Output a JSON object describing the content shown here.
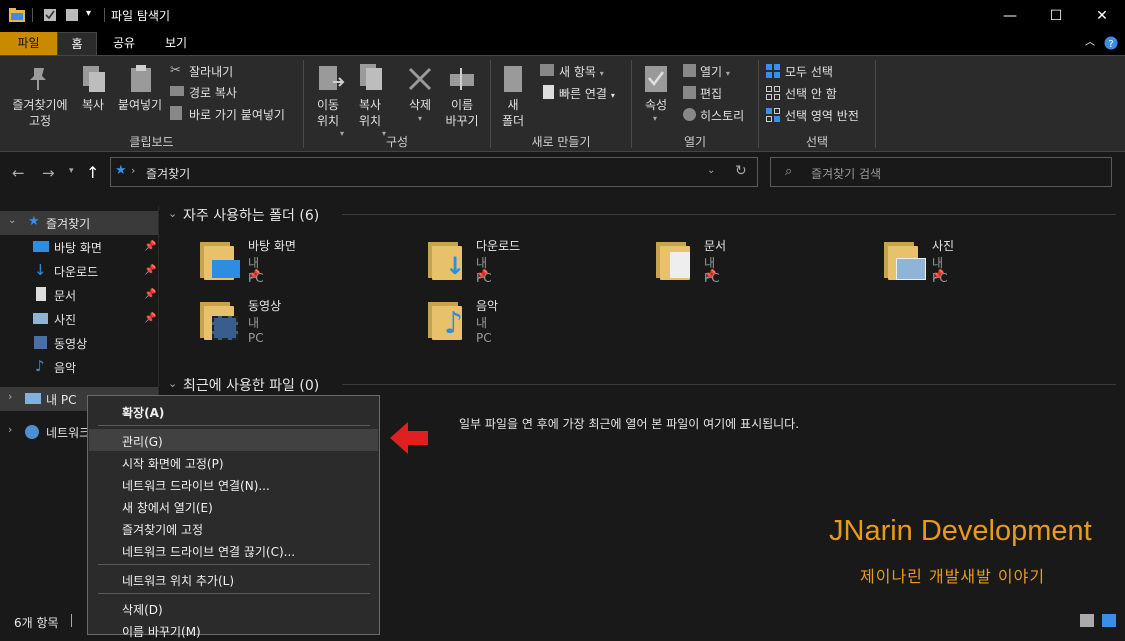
{
  "window": {
    "title": "파일 탐색기",
    "minimize": "—",
    "maximize": "☐",
    "close": "✕"
  },
  "tabs": {
    "file": "파일",
    "home": "홈",
    "share": "공유",
    "view": "보기"
  },
  "ribbon": {
    "clipboard": {
      "pin_quick": "즐겨찾기에\n고정",
      "copy": "복사",
      "paste": "붙여넣기",
      "cut": "잘라내기",
      "copy_path": "경로 복사",
      "paste_shortcut": "바로 가기 붙여넣기",
      "group": "클립보드"
    },
    "organize": {
      "move_to": "이동\n위치",
      "copy_to": "복사\n위치",
      "delete": "삭제",
      "rename": "이름\n바꾸기",
      "group": "구성"
    },
    "new": {
      "new_folder": "새\n폴더",
      "new_item": "새 항목",
      "easy_access": "빠른 연결",
      "group": "새로 만들기"
    },
    "open": {
      "properties": "속성",
      "open": "열기",
      "edit": "편집",
      "history": "히스토리",
      "group": "열기"
    },
    "select": {
      "select_all": "모두 선택",
      "select_none": "선택 안 함",
      "invert": "선택 영역 반전",
      "group": "선택"
    }
  },
  "address": {
    "path": "즐겨찾기",
    "search_placeholder": "즐겨찾기 검색"
  },
  "nav": {
    "quick_access": "즐겨찾기",
    "items": [
      "바탕 화면",
      "다운로드",
      "문서",
      "사진",
      "동영상",
      "음악"
    ],
    "this_pc": "내 PC",
    "network": "네트워크"
  },
  "content": {
    "frequent_header": "자주 사용하는 폴더 (6)",
    "recent_header": "최근에 사용한 파일 (0)",
    "folders": [
      {
        "name": "바탕 화면",
        "sub": "내 PC"
      },
      {
        "name": "다운로드",
        "sub": "내 PC"
      },
      {
        "name": "문서",
        "sub": "내 PC"
      },
      {
        "name": "사진",
        "sub": "내 PC"
      },
      {
        "name": "동영상",
        "sub": "내 PC"
      },
      {
        "name": "음악",
        "sub": "내 PC"
      }
    ],
    "recent_empty": "일부 파일을 연 후에 가장 최근에 열어 본 파일이 여기에 표시됩니다."
  },
  "context_menu": {
    "items": [
      "확장(A)",
      "관리(G)",
      "시작 화면에 고정(P)",
      "네트워크 드라이브 연결(N)...",
      "새 창에서 열기(E)",
      "즐겨찾기에 고정",
      "네트워크 드라이브 연결 끊기(C)...",
      "네트워크 위치 추가(L)",
      "삭제(D)",
      "이름 바꾸기(M)"
    ]
  },
  "status": {
    "count": "6개 항목"
  },
  "watermark": {
    "title": "JNarin Development",
    "subtitle": "제이나린 개발새발 이야기"
  },
  "colors": {
    "accent_file_tab": "#c98a00",
    "folder": "#e8c26a",
    "arrow": "#e02020",
    "watermark": "#e89a1a"
  }
}
